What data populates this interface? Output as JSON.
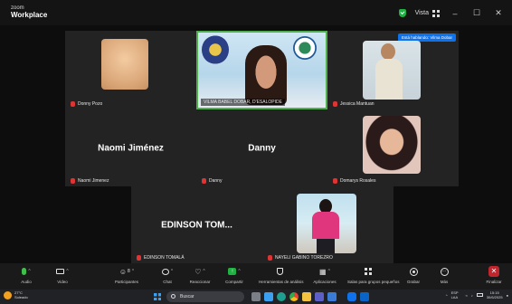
{
  "app": {
    "brand_top": "zoom",
    "brand_bottom": "Workplace"
  },
  "titlebar": {
    "view_label": "Vista",
    "minimize": "–",
    "maximize": "☐",
    "close": "✕"
  },
  "speaker_banner": "Está hablando: Vilma Dobar",
  "tiles": [
    {
      "id": "donny",
      "name": "Donny Pozo",
      "video": true
    },
    {
      "id": "host",
      "name": "VILMA BABEL DOBAR, D'ESALOPIDE",
      "video": true
    },
    {
      "id": "jessica",
      "name": "Jessica Mantuan",
      "video": true
    },
    {
      "id": "naomi",
      "name": "Naomi Jimenez",
      "display_name": "Naomi Jiménez",
      "video": false
    },
    {
      "id": "danny",
      "name": "Danny",
      "display_name": "Danny",
      "video": false
    },
    {
      "id": "domarys",
      "name": "Domarys Rosales",
      "video": true
    },
    {
      "id": "edinson",
      "name": "EDINSON TOMALÁ",
      "display_name": "EDINSON TOM...",
      "video": false
    },
    {
      "id": "nayeli",
      "name": "NAYELI GABINO TOREZRO",
      "video": true
    }
  ],
  "toolbar": [
    {
      "id": "audio",
      "label": "Audio",
      "icon": "microphone-icon"
    },
    {
      "id": "video",
      "label": "Video",
      "icon": "video-camera-icon"
    },
    {
      "id": "participants",
      "label": "Participantes",
      "icon": "participants-icon",
      "count": "8"
    },
    {
      "id": "chat",
      "label": "Chat",
      "icon": "chat-icon"
    },
    {
      "id": "react",
      "label": "Reaccionar",
      "icon": "heart-icon"
    },
    {
      "id": "share",
      "label": "Compartir",
      "icon": "share-screen-icon"
    },
    {
      "id": "summary",
      "label": "Herramientas de análisis",
      "icon": "shield-icon"
    },
    {
      "id": "apps",
      "label": "Aplicaciones",
      "icon": "apps-icon"
    },
    {
      "id": "rooms",
      "label": "Salas para grupos pequeños",
      "icon": "breakout-rooms-icon"
    },
    {
      "id": "record",
      "label": "Grabar",
      "icon": "record-icon"
    },
    {
      "id": "more",
      "label": "Más",
      "icon": "more-icon"
    }
  ],
  "leave": {
    "label": "Finalizar"
  },
  "taskbar": {
    "weather_temp": "27°C",
    "weather_desc": "Soleado",
    "search_placeholder": "Buscar",
    "lang": "ESP LAA",
    "time": "15:15",
    "date": "30/6/2025"
  },
  "colors": {
    "accent": "#0e72ed",
    "danger": "#c0262e",
    "mic_off": "#e03434",
    "security": "#1fb141"
  }
}
